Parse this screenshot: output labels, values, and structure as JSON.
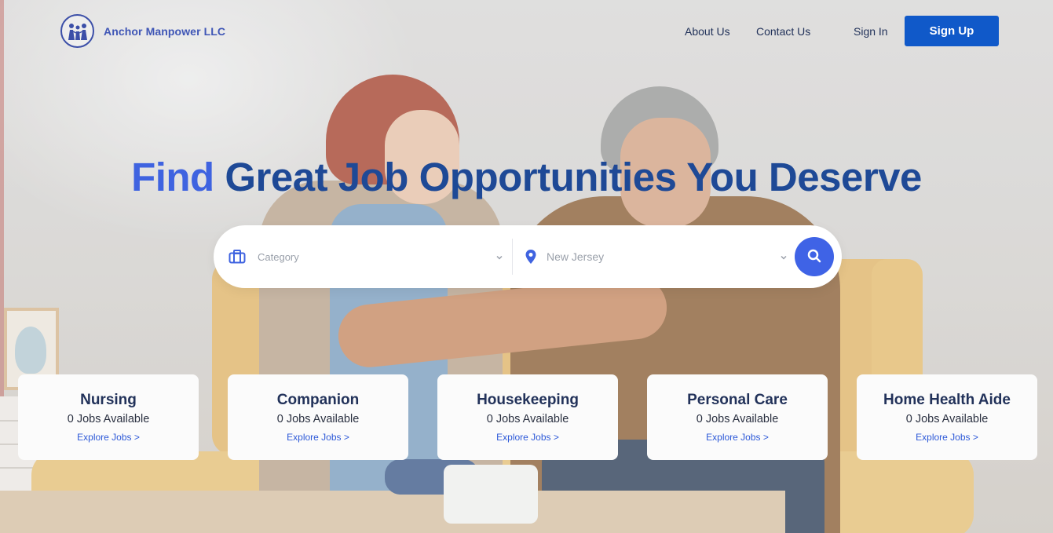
{
  "brand": {
    "name": "Anchor Manpower LLC",
    "logo_icon": "family-people-icon"
  },
  "nav": {
    "about": "About Us",
    "contact": "Contact Us",
    "sign_in": "Sign In",
    "sign_up": "Sign Up"
  },
  "hero": {
    "headline_accent": "Find",
    "headline_main": "Great Job Opportunities You Deserve"
  },
  "search": {
    "category_placeholder": "Category",
    "category_icon": "briefcase-icon",
    "location_value": "New Jersey",
    "location_icon": "map-pin-icon",
    "button_icon": "search-icon"
  },
  "categories": [
    {
      "title": "Nursing",
      "count": "0 Jobs Available",
      "link": "Explore Jobs >"
    },
    {
      "title": "Companion",
      "count": "0 Jobs Available",
      "link": "Explore Jobs >"
    },
    {
      "title": "Housekeeping",
      "count": "0 Jobs Available",
      "link": "Explore Jobs >"
    },
    {
      "title": "Personal Care",
      "count": "0 Jobs Available",
      "link": "Explore Jobs >"
    },
    {
      "title": "Home Health Aide",
      "count": "0 Jobs Available",
      "link": "Explore Jobs >"
    }
  ],
  "colors": {
    "primary_button": "#1059c9",
    "headline_accent": "#3f63e0",
    "headline_main": "#1e4996",
    "search_button": "#3f63e6",
    "link": "#2d59d8"
  }
}
